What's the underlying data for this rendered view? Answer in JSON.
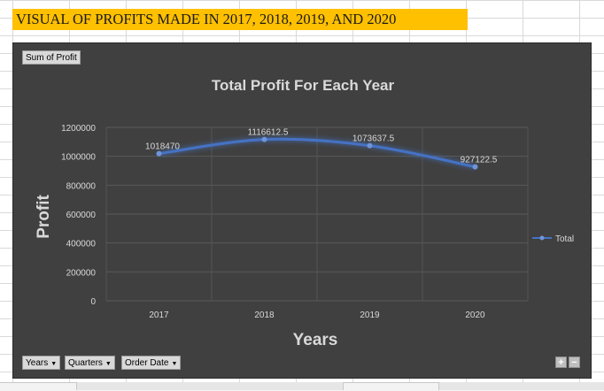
{
  "banner_title": "VISUAL OF PROFITS MADE IN 2017, 2018, 2019, AND 2020",
  "sum_field_label": "Sum of Profit",
  "filter_buttons": [
    {
      "label": "Years"
    },
    {
      "label": "Quarters"
    },
    {
      "label": "Order Date"
    }
  ],
  "zoom": {
    "plus": "+",
    "minus": "−"
  },
  "colors": {
    "banner": "#ffc000",
    "chart_background": "#404040",
    "series_line": "#4472c4",
    "text": "#d9d9d9"
  },
  "chart_data": {
    "type": "line",
    "title": "Total Profit For Each Year",
    "xlabel": "Years",
    "ylabel": "Profit",
    "categories": [
      "2017",
      "2018",
      "2019",
      "2020"
    ],
    "series": [
      {
        "name": "Total",
        "values": [
          1018470,
          1116612.5,
          1073637.5,
          927122.5
        ]
      }
    ],
    "data_labels": [
      "1018470",
      "1116612.5",
      "1073637.5",
      "927122.5"
    ],
    "y_ticks": [
      "0",
      "200000",
      "400000",
      "600000",
      "800000",
      "1000000",
      "1200000"
    ],
    "ylim": [
      0,
      1200000
    ],
    "grid": true,
    "legend": "right",
    "smoothed": true
  }
}
